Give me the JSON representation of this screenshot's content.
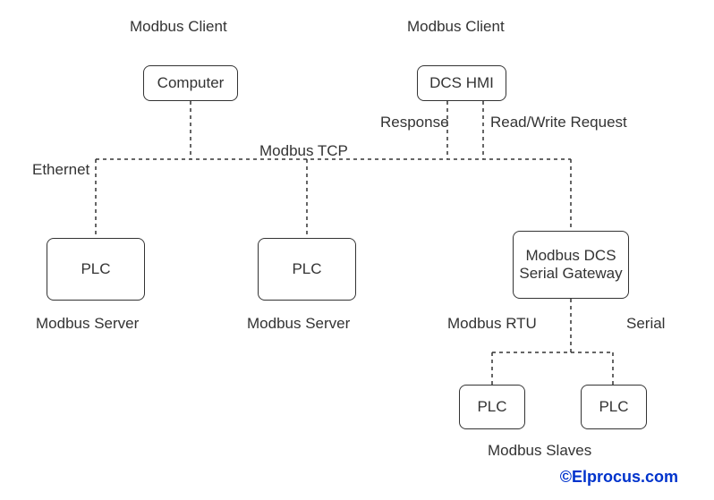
{
  "diagram": {
    "title_client_left": "Modbus Client",
    "title_client_right": "Modbus Client",
    "nodes": {
      "computer": "Computer",
      "dcs_hmi": "DCS HMI",
      "plc1": "PLC",
      "plc2": "PLC",
      "gateway": "Modbus DCS Serial Gateway",
      "plc3": "PLC",
      "plc4": "PLC"
    },
    "labels": {
      "ethernet": "Ethernet",
      "modbus_tcp": "Modbus TCP",
      "response": "Response",
      "read_write": "Read/Write Request",
      "server1": "Modbus Server",
      "server2": "Modbus Server",
      "modbus_rtu": "Modbus RTU",
      "serial": "Serial",
      "slaves": "Modbus Slaves"
    },
    "watermark": "©Elprocus.com"
  },
  "chart_data": {
    "type": "diagram",
    "description": "Modbus TCP/RTU network architecture",
    "nodes": [
      {
        "id": "computer",
        "label": "Computer",
        "role": "Modbus Client"
      },
      {
        "id": "dcs_hmi",
        "label": "DCS HMI",
        "role": "Modbus Client"
      },
      {
        "id": "plc1",
        "label": "PLC",
        "role": "Modbus Server"
      },
      {
        "id": "plc2",
        "label": "PLC",
        "role": "Modbus Server"
      },
      {
        "id": "gateway",
        "label": "Modbus DCS Serial Gateway",
        "role": "Gateway"
      },
      {
        "id": "plc3",
        "label": "PLC",
        "role": "Modbus Slave"
      },
      {
        "id": "plc4",
        "label": "PLC",
        "role": "Modbus Slave"
      }
    ],
    "edges": [
      {
        "from": "computer",
        "to": "bus_tcp",
        "label": "Ethernet / Modbus TCP"
      },
      {
        "from": "dcs_hmi",
        "to": "bus_tcp",
        "label": "Response"
      },
      {
        "from": "dcs_hmi",
        "to": "bus_tcp",
        "label": "Read/Write Request"
      },
      {
        "from": "bus_tcp",
        "to": "plc1"
      },
      {
        "from": "bus_tcp",
        "to": "plc2"
      },
      {
        "from": "bus_tcp",
        "to": "gateway"
      },
      {
        "from": "gateway",
        "to": "bus_rtu",
        "label": "Modbus RTU / Serial"
      },
      {
        "from": "bus_rtu",
        "to": "plc3"
      },
      {
        "from": "bus_rtu",
        "to": "plc4"
      }
    ]
  }
}
